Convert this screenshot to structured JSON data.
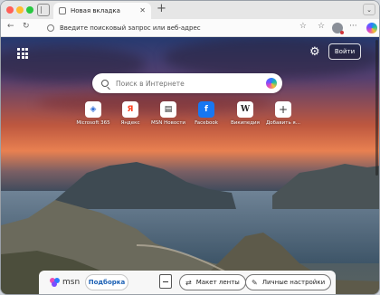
{
  "tab": {
    "title": "Новая вкладка",
    "close": "✕",
    "new_tab": "+",
    "menu": "⌄"
  },
  "toolbar": {
    "back": "←",
    "reload": "↻",
    "address_placeholder": "Введите поисковый запрос или веб-адрес",
    "favorite_star": "☆",
    "favorites": "☆",
    "more": "···"
  },
  "page": {
    "login_label": "Войти",
    "settings_glyph": "⚙",
    "search": {
      "placeholder": "Поиск в Интернете"
    },
    "tiles": [
      {
        "label": "Microsoft 365",
        "glyph": "◈",
        "color": "#2b6bd6"
      },
      {
        "label": "Яндекс",
        "glyph": "Я",
        "color": "#fc3f1d"
      },
      {
        "label": "MSN Новости",
        "glyph": "▤",
        "color": "#222222"
      },
      {
        "label": "Facebook",
        "glyph": "f",
        "color": "#1877f2"
      },
      {
        "label": "Википедия",
        "glyph": "W",
        "color": "#222222"
      },
      {
        "label": "Добавить я...",
        "glyph": "+",
        "color": "#333333"
      }
    ]
  },
  "bottom": {
    "msn_label": "msn",
    "feed_button": "Подборка",
    "layout_button": "Макет ленты",
    "layout_icon": "⇄",
    "personal_button": "Личные настройки",
    "personal_icon": "✎"
  }
}
